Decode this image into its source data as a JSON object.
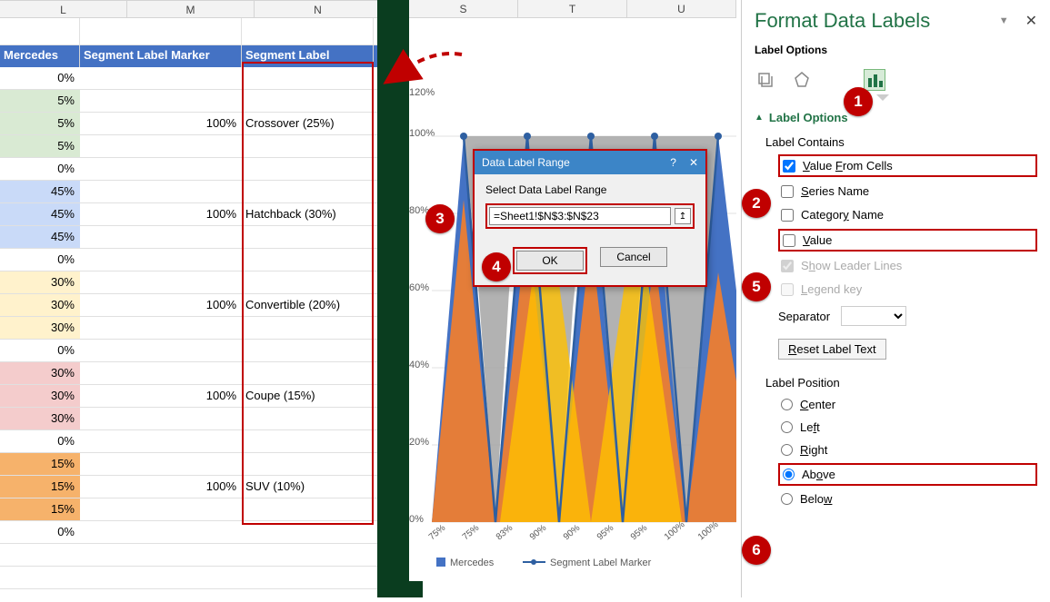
{
  "columns_1": [
    "L",
    "M",
    "N"
  ],
  "columns_2": [
    "S",
    "T",
    "U"
  ],
  "data_headers": {
    "L": "Mercedes",
    "M": "Segment Label Marker",
    "N": "Segment Label"
  },
  "rows": [
    {
      "L": "0%",
      "M": "",
      "N": "",
      "fill": "#ffffff"
    },
    {
      "L": "5%",
      "M": "",
      "N": "",
      "fill": "#d9ead3"
    },
    {
      "L": "5%",
      "M": "100%",
      "N": "Crossover (25%)",
      "fill": "#d9ead3"
    },
    {
      "L": "5%",
      "M": "",
      "N": "",
      "fill": "#d9ead3"
    },
    {
      "L": "0%",
      "M": "",
      "N": "",
      "fill": "#ffffff"
    },
    {
      "L": "45%",
      "M": "",
      "N": "",
      "fill": "#c9daf8"
    },
    {
      "L": "45%",
      "M": "100%",
      "N": "Hatchback (30%)",
      "fill": "#c9daf8"
    },
    {
      "L": "45%",
      "M": "",
      "N": "",
      "fill": "#c9daf8"
    },
    {
      "L": "0%",
      "M": "",
      "N": "",
      "fill": "#ffffff"
    },
    {
      "L": "30%",
      "M": "",
      "N": "",
      "fill": "#fff2cc"
    },
    {
      "L": "30%",
      "M": "100%",
      "N": "Convertible (20%)",
      "fill": "#fff2cc"
    },
    {
      "L": "30%",
      "M": "",
      "N": "",
      "fill": "#fff2cc"
    },
    {
      "L": "0%",
      "M": "",
      "N": "",
      "fill": "#ffffff"
    },
    {
      "L": "30%",
      "M": "",
      "N": "",
      "fill": "#f4cccc"
    },
    {
      "L": "30%",
      "M": "100%",
      "N": "Coupe (15%)",
      "fill": "#f4cccc"
    },
    {
      "L": "30%",
      "M": "",
      "N": "",
      "fill": "#f4cccc"
    },
    {
      "L": "0%",
      "M": "",
      "N": "",
      "fill": "#ffffff"
    },
    {
      "L": "15%",
      "M": "",
      "N": "",
      "fill": "#f6b26b"
    },
    {
      "L": "15%",
      "M": "100%",
      "N": "SUV (10%)",
      "fill": "#f6b26b"
    },
    {
      "L": "15%",
      "M": "",
      "N": "",
      "fill": "#f6b26b"
    },
    {
      "L": "0%",
      "M": "",
      "N": "",
      "fill": "#ffffff"
    }
  ],
  "dialog": {
    "title": "Data Label Range",
    "help": "?",
    "close": "✕",
    "prompt": "Select Data Label Range",
    "value": "=Sheet1!$N$3:$N$23",
    "ok": "OK",
    "cancel": "Cancel"
  },
  "pane": {
    "title": "Format Data Labels",
    "sub": "Label Options",
    "section": "Label Options",
    "label_contains": "Label Contains",
    "value_from_cells": "Value From Cells",
    "series_name": "Series Name",
    "category_name": "Category Name",
    "value": "Value",
    "show_leader": "Show Leader Lines",
    "legend_key": "Legend key",
    "separator": "Separator",
    "reset": "Reset Label Text",
    "label_position": "Label Position",
    "center": "Center",
    "left": "Left",
    "right": "Right",
    "above": "Above",
    "below": "Below"
  },
  "steps": {
    "s1": "1",
    "s2": "2",
    "s3": "3",
    "s4": "4",
    "s5": "5",
    "s6": "6"
  },
  "chart_data": {
    "type": "area",
    "x_tick_labels": [
      "75%",
      "75%",
      "83%",
      "90%",
      "90%",
      "95%",
      "95%",
      "100%",
      "100%"
    ],
    "ylim": [
      0,
      120
    ],
    "y_axis_ticks": [
      "0%",
      "20%",
      "40%",
      "60%",
      "80%",
      "100%",
      "120%"
    ],
    "legend": [
      "Mercedes",
      "Segment Label Marker"
    ],
    "series": [
      {
        "name": "blue",
        "color": "#4472c4"
      },
      {
        "name": "orange",
        "color": "#ed7d31"
      },
      {
        "name": "gray",
        "color": "#a5a5a5"
      },
      {
        "name": "yellow",
        "color": "#ffc000"
      },
      {
        "name": "marker",
        "type": "line",
        "color": "#2e5fa1"
      }
    ]
  }
}
